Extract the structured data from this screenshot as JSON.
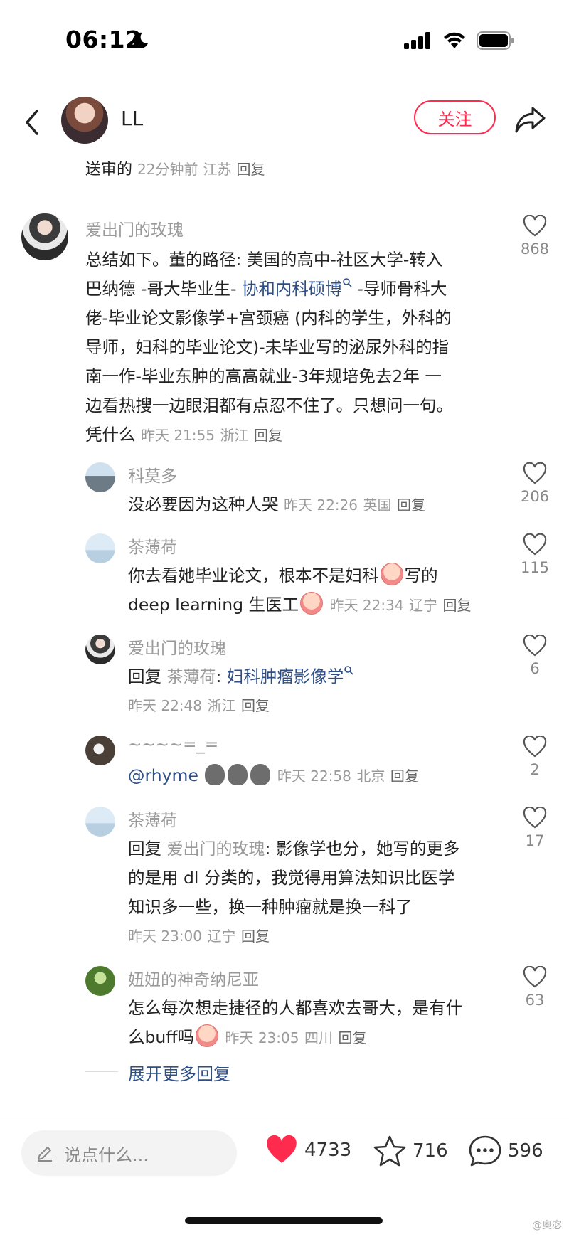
{
  "status": {
    "time": "06:12"
  },
  "header": {
    "username": "LL",
    "follow_label": "关注"
  },
  "top_snippet": {
    "text": "送审的",
    "time": "22分钟前",
    "location": "江苏",
    "reply_label": "回复"
  },
  "comments": [
    {
      "author": "爱出门的玫瑰",
      "lines": [
        "总结如下。董的路径: 美国的高中-社区大学-转入",
        "巴纳德 -哥大毕业生- ",
        "协和内科硕博",
        " -导师骨科大",
        "佬-毕业论文影像学+宫颈癌 (内科的学生，外科的",
        "导师，妇科的毕业论文)-未毕业写的泌尿外科的指",
        "南一作-毕业东肿的高高就业-3年规培免去2年  一",
        "边看热搜一边眼泪都有点忍不住了。只想问一句。",
        "凭什么"
      ],
      "time": "昨天 21:55",
      "location": "浙江",
      "reply_label": "回复",
      "likes": "868"
    },
    {
      "author": "科莫多",
      "text": "没必要因为这种人哭",
      "time": "昨天 22:26",
      "location": "英国",
      "reply_label": "回复",
      "likes": "206"
    },
    {
      "author": "茶薄荷",
      "line1": "你去看她毕业论文，根本不是妇科",
      "line1b": "写的",
      "line2": "deep learning 生医工",
      "time": "昨天 22:34",
      "location": "辽宁",
      "reply_label": "回复",
      "likes": "115"
    },
    {
      "author": "爱出门的玫瑰",
      "reply_prefix": "回复",
      "reply_to": "茶薄荷",
      "text": "妇科肿瘤影像学",
      "time": "昨天 22:48",
      "location": "浙江",
      "reply_label": "回复",
      "likes": "6"
    },
    {
      "author": "~~~~=_=",
      "text": "@rhyme",
      "time": "昨天 22:58",
      "location": "北京",
      "reply_label": "回复",
      "likes": "2"
    },
    {
      "author": "茶薄荷",
      "reply_prefix": "回复",
      "reply_to": "爱出门的玫瑰",
      "line1": ": 影像学也分，她写的更多",
      "line2": "的是用 dl 分类的，我觉得用算法知识比医学",
      "line3": "知识多一些，换一种肿瘤就是换一科了",
      "time": "昨天 23:00",
      "location": "辽宁",
      "reply_label": "回复",
      "likes": "17"
    },
    {
      "author": "妞妞的神奇纳尼亚",
      "line1": "怎么每次想走捷径的人都喜欢去哥大，是有什",
      "line2": "么buff吗",
      "time": "昨天 23:05",
      "location": "四川",
      "reply_label": "回复",
      "likes": "63"
    }
  ],
  "expand_label": "展开更多回复",
  "bottom": {
    "input_placeholder": "说点什么...",
    "likes": "4733",
    "stars": "716",
    "comments": "596"
  },
  "watermark": "@奥宓",
  "colors": {
    "accent": "#ff2b4e",
    "link": "#2e4e86",
    "meta": "#9a9a9a"
  }
}
